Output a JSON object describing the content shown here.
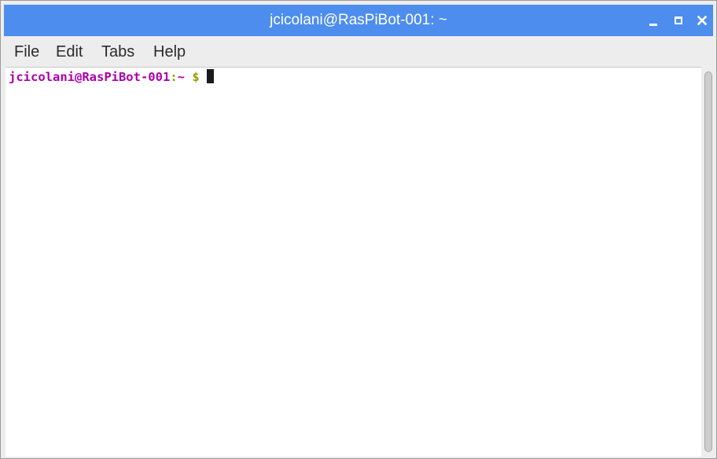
{
  "window": {
    "title": "jcicolani@RasPiBot-001: ~",
    "accent_color": "#4d8ded",
    "buttons": {
      "minimize_icon": "minimize-icon",
      "maximize_icon": "maximize-icon",
      "close_icon": "close-icon"
    }
  },
  "menubar": {
    "items": [
      {
        "label": "File"
      },
      {
        "label": "Edit"
      },
      {
        "label": "Tabs"
      },
      {
        "label": "Help"
      }
    ]
  },
  "terminal": {
    "prompt_user_host": "jcicolani@RasPiBot-001",
    "prompt_colon": ":",
    "prompt_path": "~",
    "prompt_symbol": "$",
    "user_color": "#aa00aa",
    "symbol_color": "#9a9a00"
  }
}
